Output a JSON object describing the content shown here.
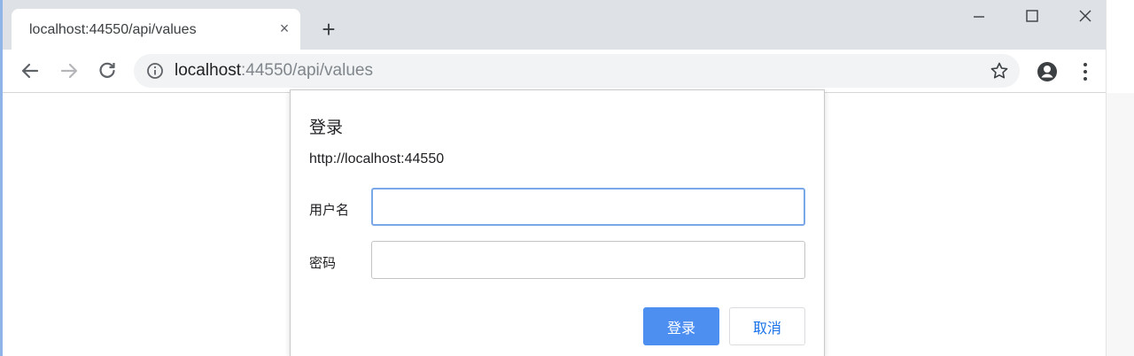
{
  "tab": {
    "title": "localhost:44550/api/values",
    "close_label": "×"
  },
  "new_tab_label": "+",
  "address_bar": {
    "host": "localhost",
    "rest": ":44550/api/values"
  },
  "dialog": {
    "title": "登录",
    "origin": "http://localhost:44550",
    "username_label": "用户名",
    "username_value": "",
    "password_label": "密码",
    "password_value": "",
    "login_button": "登录",
    "cancel_button": "取消"
  },
  "icons": {
    "back": "arrow-left-icon",
    "forward": "arrow-right-icon",
    "reload": "reload-icon",
    "info": "info-icon",
    "star": "star-icon",
    "account": "account-icon",
    "menu": "more-vert-icon"
  },
  "colors": {
    "accent": "#4d8ff0",
    "focus_border": "#7aa7e8",
    "tabstrip": "#dee1e6",
    "omnibox": "#f1f3f4"
  }
}
